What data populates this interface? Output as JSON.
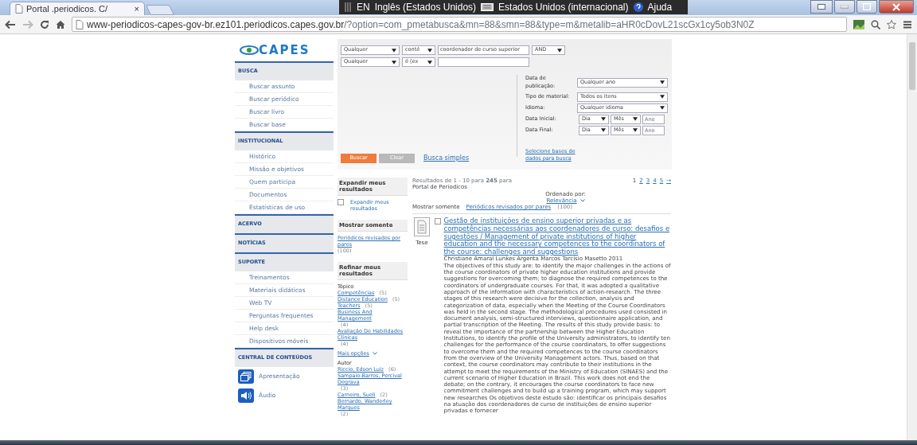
{
  "browser": {
    "tab_title": "Portal .periodicos. C/",
    "tab_close": "×",
    "language_bar": {
      "code": "EN",
      "language": "Inglês (Estados Unidos)",
      "keyboard": "Estados Unidos (internacional)",
      "help": "Ajuda"
    },
    "url_host": "www-periodicos-capes-gov-br.ez101.periodicos.capes.gov.br",
    "url_rest": "/?option=com_pmetabusca&mn=88&smn=88&type=m&metalib=aHR0cDovL21scGx1cy5ob3N0Z"
  },
  "sidebar": {
    "logo": "CAPES",
    "sections": [
      {
        "title": "BUSCA",
        "items": [
          {
            "label": "Buscar assunto",
            "kind": "link"
          },
          {
            "label": "Buscar periódico",
            "kind": "link"
          },
          {
            "label": "Buscar livro",
            "kind": "link"
          },
          {
            "label": "Buscar base",
            "kind": "link"
          }
        ]
      },
      {
        "title": "INSTITUCIONAL",
        "items": [
          {
            "label": "Histórico",
            "kind": "link"
          },
          {
            "label": "Missão e objetivos",
            "kind": "link"
          },
          {
            "label": "Quem participa",
            "kind": "link"
          },
          {
            "label": "Documentos",
            "kind": "link"
          },
          {
            "label": "Estatísticas de uso",
            "kind": "link"
          }
        ]
      },
      {
        "title": "ACERVO"
      },
      {
        "title": "NOTÍCIAS"
      },
      {
        "title": "SUPORTE",
        "items": [
          {
            "label": "Treinamentos",
            "kind": "link"
          },
          {
            "label": "Materiais didáticos",
            "kind": "link"
          },
          {
            "label": "Web TV",
            "kind": "link"
          },
          {
            "label": "Perguntas frequentes",
            "kind": "link"
          },
          {
            "label": "Help desk",
            "kind": "link"
          },
          {
            "label": "Dispositivos móveis",
            "kind": "link"
          }
        ]
      },
      {
        "title": "CENTRAL DE CONTEÚDOS",
        "items": [
          {
            "label": "Apresentação",
            "kind": "media"
          },
          {
            "label": "Áudio",
            "kind": "media"
          }
        ]
      }
    ]
  },
  "search": {
    "criteria": [
      {
        "field": "Qualquer",
        "operator": "conté",
        "value": "coordenador de curso superior",
        "boolean": "AND"
      },
      {
        "field": "Qualquer",
        "operator": "é (ex"
      }
    ],
    "filters": [
      {
        "label": "Data de publicação:",
        "kind": "select",
        "value": "Qualquer ano"
      },
      {
        "label": "Tipo de material:",
        "kind": "select",
        "value": "Todos os itens"
      },
      {
        "label": "Idioma:",
        "kind": "select",
        "value": "Qualquer idioma"
      },
      {
        "label": "Data Inicial:",
        "kind": "date",
        "day": "Dia",
        "month": "Mês",
        "year_placeholder": "Ano"
      },
      {
        "label": "Data Final:",
        "kind": "date",
        "day": "Dia",
        "month": "Mês",
        "year_placeholder": "Ano"
      }
    ],
    "databases_link": "Selecione bases de dados para busca",
    "buttons": [
      {
        "label": "Buscar",
        "kind": "primary"
      },
      {
        "label": "Clear",
        "kind": "secondary"
      }
    ],
    "simple_link": "Busca simples"
  },
  "facets": {
    "expand": {
      "title": "Expandir meus resultados",
      "checkbox": {
        "label": "Expandir meus resultados",
        "checked": false
      }
    },
    "show_only": {
      "title": "Mostrar somente",
      "link": "Periódicos revisados por pares",
      "count": "(100)"
    },
    "refine": {
      "title": "Refinar meus resultados",
      "groups": [
        {
          "title": "Tópico",
          "items": [
            {
              "label": "Competências",
              "count": "(5)"
            },
            {
              "label": "Distance Education",
              "count": "(5)"
            },
            {
              "label": "Teachers",
              "count": "(5)"
            },
            {
              "label": "Business And Management",
              "count": "(4)"
            },
            {
              "label": "Avaliação De Habilidades Clínicas",
              "count": "(4)"
            }
          ],
          "more": "Mais opções"
        },
        {
          "title": "Autor",
          "items": [
            {
              "label": "Riccio, Edson Luiz",
              "count": "(6)"
            },
            {
              "label": "Sampaio-Barros, Percival Degrava",
              "count": "(3)"
            },
            {
              "label": "Carneiro, Sueli",
              "count": "(2)"
            },
            {
              "label": "Bernardo, Wanderley Marques",
              "count": "(2)"
            }
          ]
        }
      ]
    }
  },
  "results": {
    "summary": "Resultados de 1 - 10 para **245** para",
    "source": "Portal de Periodicos",
    "pages": [
      {
        "label": "1",
        "selected": true
      },
      {
        "label": "2",
        "selected": false
      },
      {
        "label": "3",
        "selected": false
      },
      {
        "label": "4",
        "selected": false
      },
      {
        "label": "5",
        "selected": false
      }
    ],
    "next": "→",
    "sort_label": "Ordenado por:",
    "sort_value": "Relevância",
    "filter_label": "Mostrar somente",
    "filter_link": "Periódicos revisados por pares",
    "filter_count": "(100)",
    "items": [
      {
        "selected": false,
        "type": "Tese",
        "title": "Gestão de instituições de ensino superior privadas e as competências necessárias aos coordenadores de curso: desafios e sugestões / Management of private institutions of higher education and the necessary competences to the coordinators of the course: challenges and suggestions",
        "authors": "Christiane Amaral Lunkes Argenta Marcos Tarcísio Masetto 2011",
        "abstract": "The objectives of this study are: to identify the major challenges in the actions of the course coordinators of private higher education institutions and provide suggestions for overcoming them; to diagnose the required competences to the coordinators of undergraduate courses. For that, it was adopted a qualitative approach of the information with characteristics of action-research. The three stages of this research were decisive for the collection, analysis and categorization of data, especially when the Meeting of the Course Coordinators was held in the second stage. The methodological procedures used consisted in document analysis, semi-structured interviews, questionnaire application, and partial transcription of the Meeting. The results of this study provide basis: to reveal the importance of the partnership between the Higher Education Institutions, to identify the profile of the University administrators, to identify ten challenges for the performance of the course coordinators, to offer suggestions to overcome them and the required competences to the course coordinators from the overview of the University Management actors. Thus, based on that context, the course coordinators may contribute to their institutions in the attempt to meet the requirements of the Ministry of Education (SINAES) and the current scenario of Higher Education in Brazil. This work does not end the debate; on the contrary, it encourages the course coordinators to face new commitment challenges and to build up a training program, which may support new researches Os objetivos deste estudo são: identificar os principais desafios na atuação dos coordenadores de curso de instituições de ensino superior privadas e fornecer"
      }
    ]
  }
}
